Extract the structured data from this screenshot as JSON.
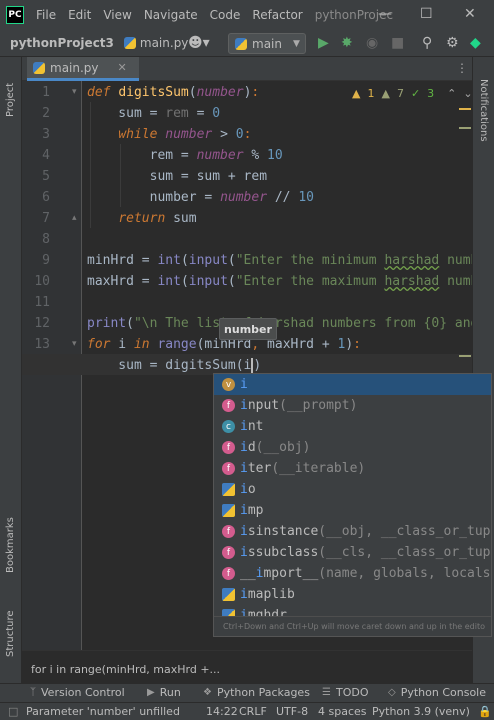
{
  "menubar": {
    "logo": "PC",
    "items": [
      "File",
      "Edit",
      "View",
      "Navigate",
      "Code",
      "Refactor"
    ],
    "project_title": "pythonProjec",
    "minimize": "—",
    "maximize": "☐",
    "close": "✕"
  },
  "toolbar": {
    "project": "pythonProject3",
    "file": "main.py",
    "run_config": "main"
  },
  "left_strip": {
    "project_label": "Project",
    "bookmarks_label": "Bookmarks",
    "structure_label": "Structure"
  },
  "right_strip": {
    "notifications_label": "Notifications"
  },
  "tabs": [
    {
      "label": "main.py",
      "close": "✕"
    }
  ],
  "inspection": {
    "warnings": "1",
    "weak_warnings": "7",
    "ok": "3"
  },
  "editor": {
    "line_numbers": [
      "1",
      "2",
      "3",
      "4",
      "5",
      "6",
      "7",
      "8",
      "9",
      "10",
      "11",
      "12",
      "13",
      "14"
    ],
    "current_line": 14
  },
  "tooltip": {
    "text": "number"
  },
  "completion": {
    "items": [
      {
        "icon": "v",
        "kind": "variable",
        "name": "i",
        "args": ""
      },
      {
        "icon": "f",
        "kind": "function",
        "name": "input",
        "args": "(__prompt)"
      },
      {
        "icon": "c",
        "kind": "class",
        "name": "int",
        "args": ""
      },
      {
        "icon": "f",
        "kind": "function",
        "name": "id",
        "args": "(__obj)"
      },
      {
        "icon": "f",
        "kind": "function",
        "name": "iter",
        "args": "(__iterable)"
      },
      {
        "icon": "m",
        "kind": "module",
        "name": "io",
        "args": ""
      },
      {
        "icon": "m",
        "kind": "module",
        "name": "imp",
        "args": ""
      },
      {
        "icon": "f",
        "kind": "function",
        "name": "isinstance",
        "args": "(__obj, __class_or_tuple"
      },
      {
        "icon": "f",
        "kind": "function",
        "name": "issubclass",
        "args": "(__cls, __class_or_tuple"
      },
      {
        "icon": "f",
        "kind": "function",
        "name": "__import__",
        "args": "(name, globals, locals,"
      },
      {
        "icon": "m",
        "kind": "module",
        "name": "imaplib",
        "args": ""
      },
      {
        "icon": "m",
        "kind": "module",
        "name": "imghdr",
        "args": ""
      }
    ],
    "hint": "Ctrl+Down and Ctrl+Up will move caret down and up in the edito"
  },
  "breadcrumb": {
    "text": "for i in range(minHrd, maxHrd +..."
  },
  "tool_windows": {
    "version_control": "Version Control",
    "run": "Run",
    "python_packages": "Python Packages",
    "todo": "TODO",
    "python_console": "Python Console"
  },
  "status": {
    "message": "Parameter 'number' unfilled",
    "position": "14:22",
    "line_sep": "CRLF",
    "encoding": "UTF-8",
    "indent": "4 spaces",
    "interpreter": "Python 3.9 (venv)"
  },
  "colors": {
    "bg": "#2b2b2b",
    "chrome": "#3c3f41",
    "keyword": "#cc7832",
    "function": "#ffc66d",
    "number": "#6897bb",
    "string": "#6a8759",
    "builtin": "#8888c6",
    "selection": "#26517a"
  }
}
